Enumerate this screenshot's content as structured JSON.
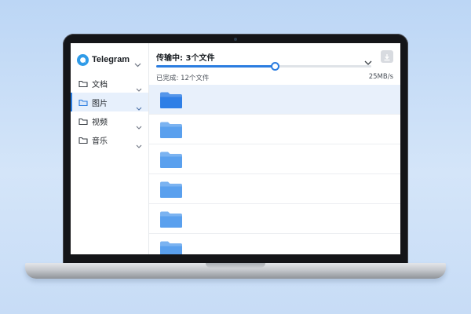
{
  "app": {
    "brand": "Telegram"
  },
  "sidebar": {
    "items": [
      {
        "label": "文档",
        "active": false
      },
      {
        "label": "图片",
        "active": true
      },
      {
        "label": "视频",
        "active": false
      },
      {
        "label": "音乐",
        "active": false
      }
    ]
  },
  "transfer": {
    "title": "传输中: 3个文件",
    "completed": "已完成: 12个文件",
    "speed": "25MB/s",
    "progress_percent": 55
  },
  "file_rows": [
    {
      "icon": "folder-icon",
      "selected": true
    },
    {
      "icon": "folder-icon",
      "selected": false
    },
    {
      "icon": "folder-icon",
      "selected": false
    },
    {
      "icon": "folder-icon",
      "selected": false
    },
    {
      "icon": "folder-icon",
      "selected": false
    },
    {
      "icon": "folder-icon",
      "selected": false
    }
  ],
  "colors": {
    "accent": "#2b7de0",
    "folder_selected": "#2f7fe6",
    "folder": "#5aa0ee",
    "selected_row": "#e8f0fb",
    "background": "#c7dcf6"
  }
}
